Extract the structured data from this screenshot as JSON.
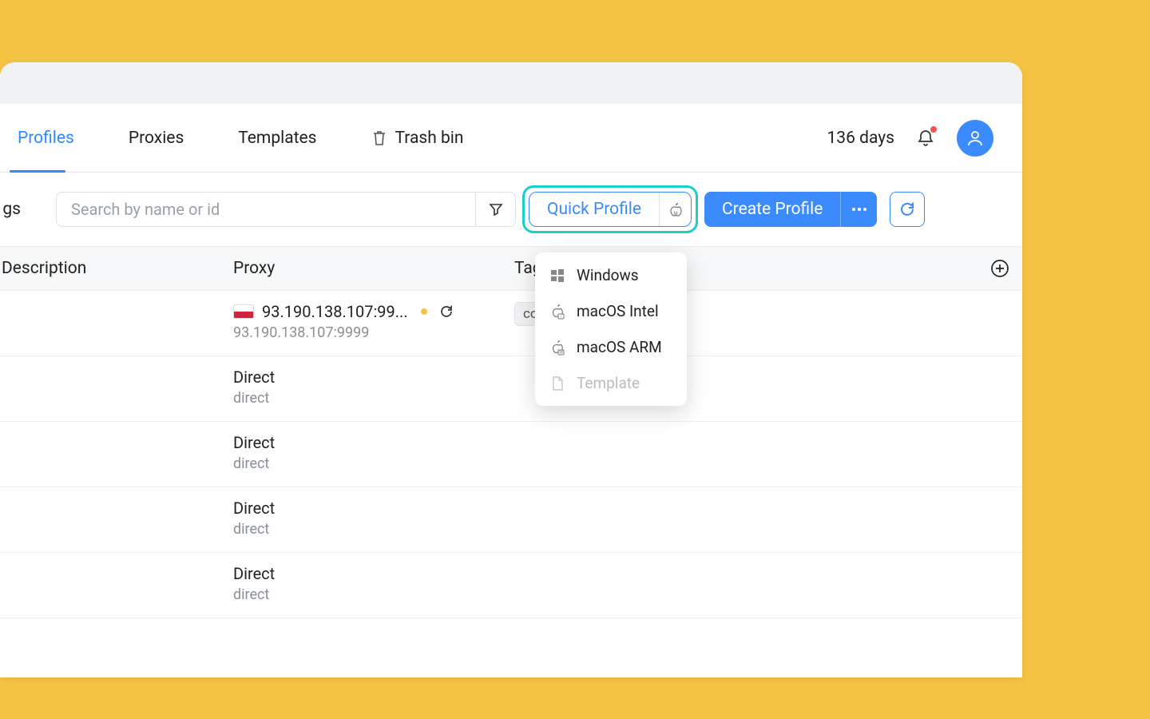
{
  "tabs": {
    "profiles": "Profiles",
    "proxies": "Proxies",
    "templates": "Templates",
    "trash": "Trash bin"
  },
  "header": {
    "days": "136 days"
  },
  "toolbar": {
    "left_fragment": "gs",
    "search_placeholder": "Search by name or id",
    "quick_profile": "Quick Profile",
    "create_profile": "Create Profile"
  },
  "dropdown": {
    "windows": "Windows",
    "macos_intel": "macOS Intel",
    "macos_arm": "macOS ARM",
    "template": "Template"
  },
  "columns": {
    "description": "Description",
    "proxy": "Proxy",
    "tags": "Tag"
  },
  "rows": [
    {
      "proxy_main": "93.190.138.107:99...",
      "proxy_sub": "93.190.138.107:9999",
      "tag": "co",
      "has_flag": true,
      "has_status": true
    },
    {
      "proxy_main": "Direct",
      "proxy_sub": "direct"
    },
    {
      "proxy_main": "Direct",
      "proxy_sub": "direct"
    },
    {
      "proxy_main": "Direct",
      "proxy_sub": "direct"
    },
    {
      "proxy_main": "Direct",
      "proxy_sub": "direct"
    }
  ]
}
